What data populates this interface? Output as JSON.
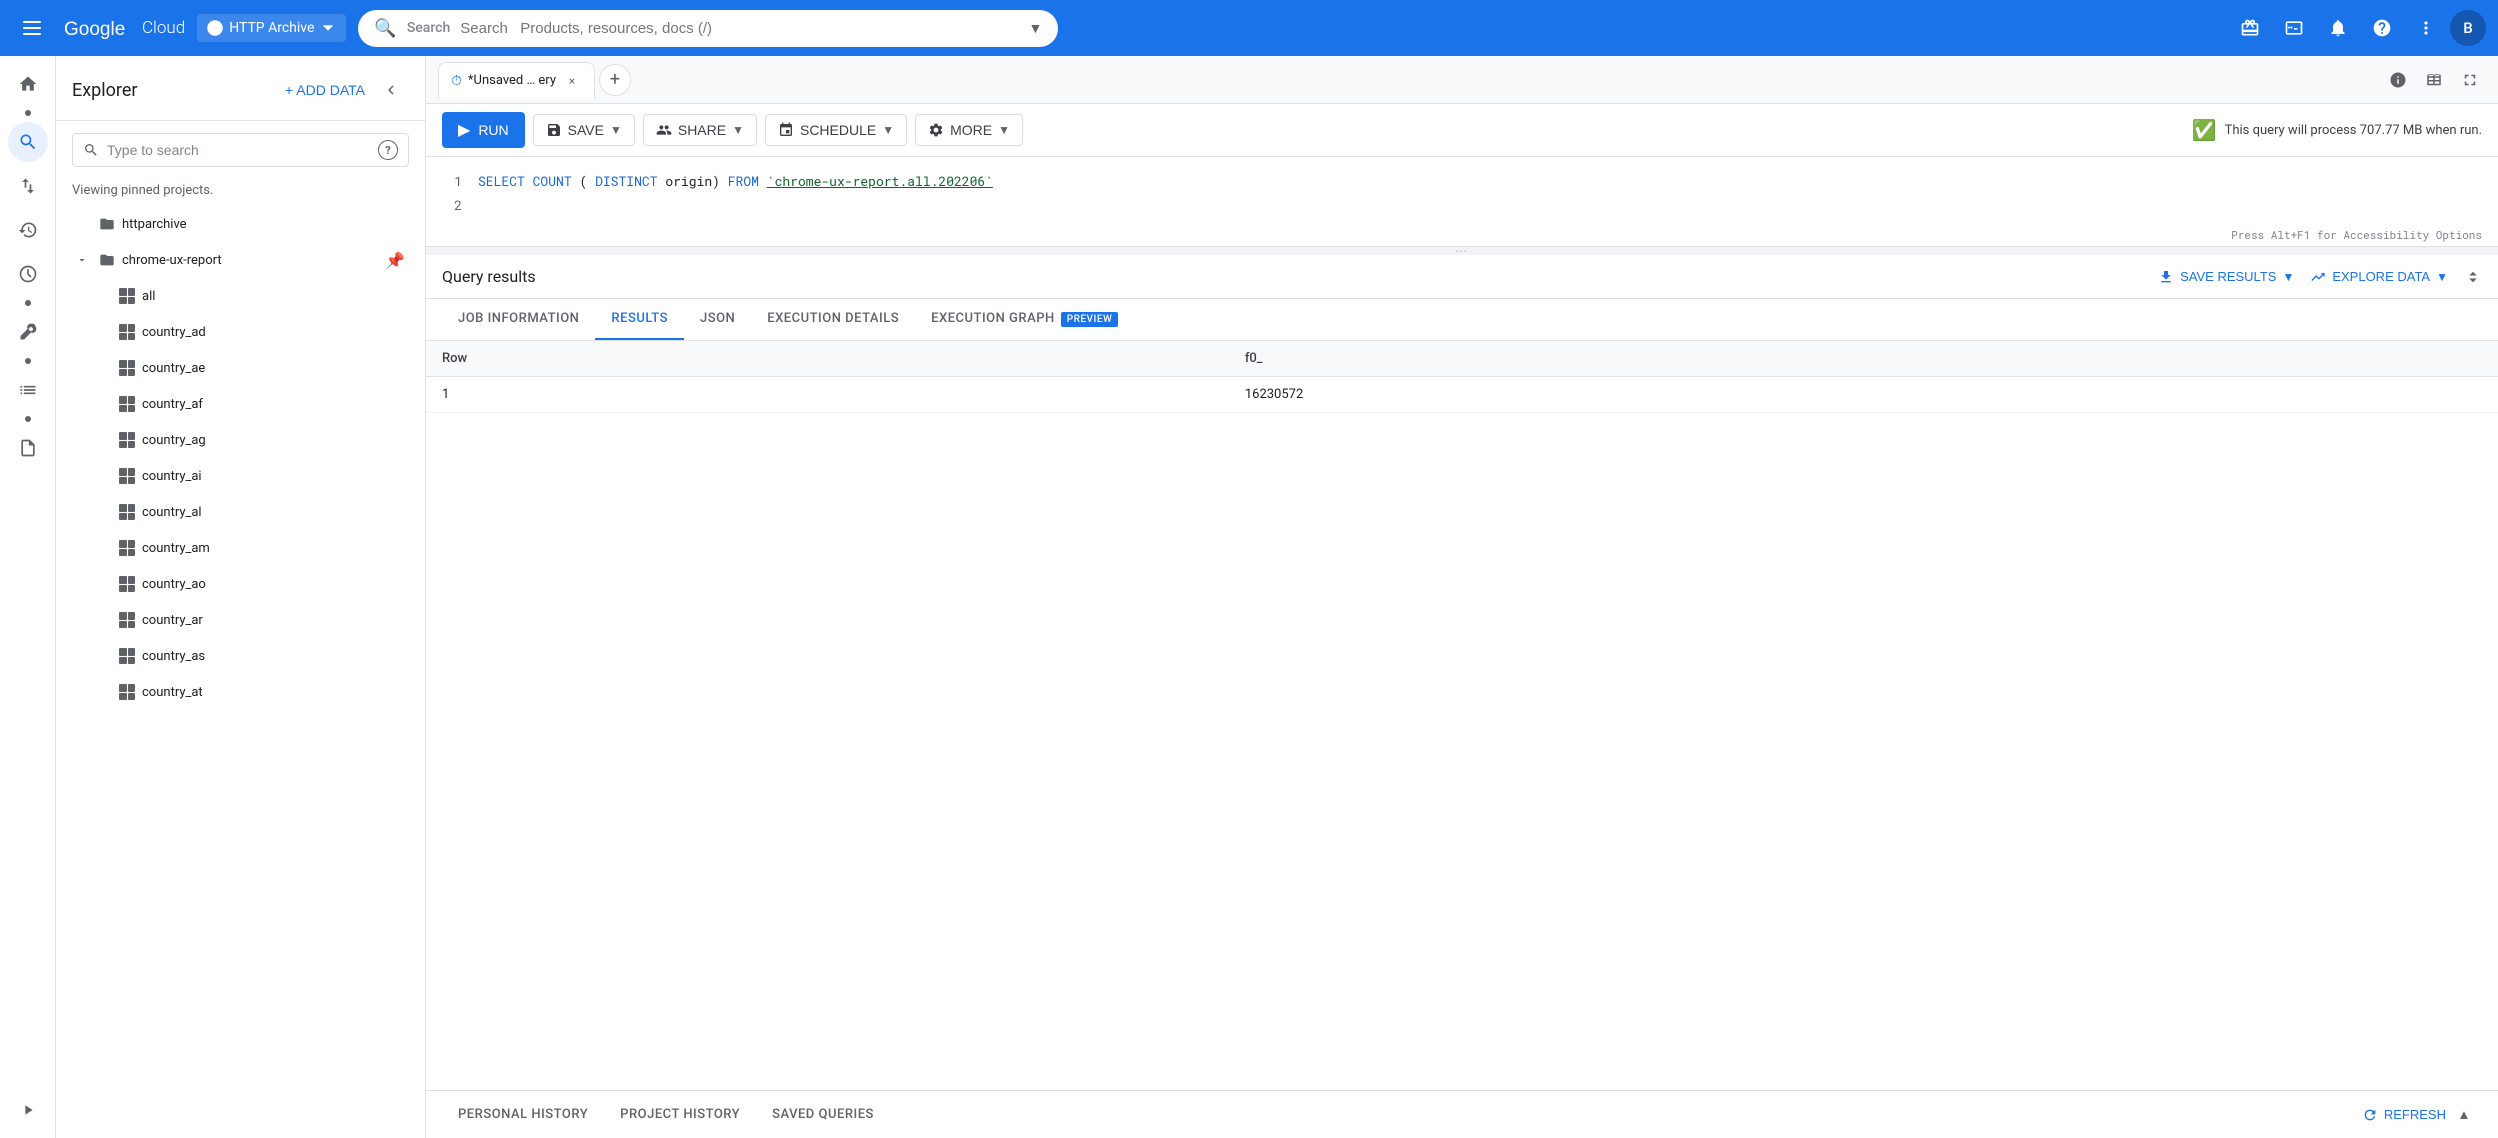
{
  "nav": {
    "app_name": "Google Cloud",
    "project": "HTTP Archive",
    "search_placeholder": "Search   Products, resources, docs (/)",
    "avatar_letter": "B"
  },
  "explorer": {
    "title": "Explorer",
    "add_data_label": "+ ADD DATA",
    "search_placeholder": "Type to search",
    "viewing_text": "Viewing pinned projects.",
    "collapse_icon": "◀",
    "tree": [
      {
        "id": "httparchive",
        "label": "httparchive",
        "expanded": false,
        "pinned": false,
        "children": []
      },
      {
        "id": "chrome-ux-report",
        "label": "chrome-ux-report",
        "expanded": true,
        "pinned": true,
        "children": [
          {
            "id": "all",
            "label": "all",
            "type": "dataset"
          },
          {
            "id": "country_ad",
            "label": "country_ad",
            "type": "dataset"
          },
          {
            "id": "country_ae",
            "label": "country_ae",
            "type": "dataset"
          },
          {
            "id": "country_af",
            "label": "country_af",
            "type": "dataset"
          },
          {
            "id": "country_ag",
            "label": "country_ag",
            "type": "dataset"
          },
          {
            "id": "country_ai",
            "label": "country_ai",
            "type": "dataset"
          },
          {
            "id": "country_al",
            "label": "country_al",
            "type": "dataset"
          },
          {
            "id": "country_am",
            "label": "country_am",
            "type": "dataset"
          },
          {
            "id": "country_ao",
            "label": "country_ao",
            "type": "dataset"
          },
          {
            "id": "country_ar",
            "label": "country_ar",
            "type": "dataset"
          },
          {
            "id": "country_as",
            "label": "country_as",
            "type": "dataset"
          },
          {
            "id": "country_at",
            "label": "country_at",
            "type": "dataset"
          }
        ]
      }
    ]
  },
  "query_tab": {
    "icon": "⏱",
    "label": "*Unsaved … ery",
    "close_label": "×"
  },
  "toolbar": {
    "run_label": "RUN",
    "save_label": "SAVE",
    "share_label": "SHARE",
    "schedule_label": "SCHEDULE",
    "more_label": "MORE",
    "query_info": "This query will process 707.77 MB when run."
  },
  "code": {
    "lines": [
      {
        "num": "1",
        "parts": [
          {
            "type": "kw",
            "text": "SELECT"
          },
          {
            "type": "fn",
            "text": " COUNT"
          },
          {
            "type": "plain",
            "text": "("
          },
          {
            "type": "kw",
            "text": "DISTINCT"
          },
          {
            "type": "plain",
            "text": " origin) "
          },
          {
            "type": "kw",
            "text": "FROM"
          },
          {
            "type": "plain",
            "text": " "
          },
          {
            "type": "str",
            "text": "`chrome-ux-report.all.202206`"
          }
        ]
      },
      {
        "num": "2",
        "parts": []
      }
    ]
  },
  "results": {
    "title": "Query results",
    "save_results_label": "SAVE RESULTS",
    "explore_data_label": "EXPLORE DATA",
    "tabs": [
      {
        "id": "job-information",
        "label": "JOB INFORMATION",
        "active": false
      },
      {
        "id": "results",
        "label": "RESULTS",
        "active": true
      },
      {
        "id": "json",
        "label": "JSON",
        "active": false
      },
      {
        "id": "execution-details",
        "label": "EXECUTION DETAILS",
        "active": false
      },
      {
        "id": "execution-graph",
        "label": "EXECUTION GRAPH",
        "active": false,
        "badge": "PREVIEW"
      }
    ],
    "table": {
      "columns": [
        "Row",
        "f0_"
      ],
      "rows": [
        [
          "1",
          "16230572"
        ]
      ]
    }
  },
  "history": {
    "tabs": [
      {
        "id": "personal-history",
        "label": "PERSONAL HISTORY"
      },
      {
        "id": "project-history",
        "label": "PROJECT HISTORY"
      },
      {
        "id": "saved-queries",
        "label": "SAVED QUERIES"
      }
    ],
    "refresh_label": "REFRESH",
    "collapse_label": "▲"
  },
  "accessibility_hint": "Press Alt+F1 for Accessibility Options"
}
